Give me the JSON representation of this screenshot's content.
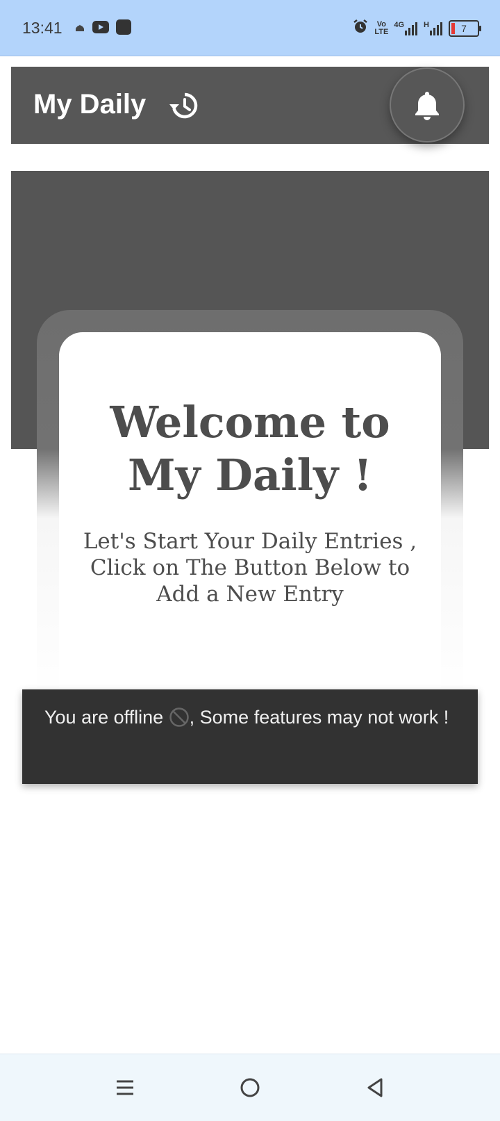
{
  "status_bar": {
    "time": "13:41",
    "left_icons": [
      "mosque-icon",
      "youtube-icon",
      "app-square-icon"
    ],
    "volte_top": "Vo",
    "volte_bottom": "LTE",
    "network_4g": "4G",
    "network_h": "H",
    "battery": "7"
  },
  "appbar": {
    "title": "My Daily",
    "history_icon": "history-icon",
    "bell_icon": "bell-icon"
  },
  "welcome_card": {
    "title": "Welcome to\nMy Daily !",
    "subtitle": "Let's Start Your Daily Entries , Click on The Button Below to Add a New Entry"
  },
  "snackbar": {
    "text_before": "You are offline ",
    "icon": "block-icon",
    "text_after": ", Some features may not work !"
  },
  "nav": {
    "icons": [
      "menu-icon",
      "home-icon",
      "back-icon"
    ]
  },
  "colors": {
    "status_bar": "#b3d4fb",
    "appbar": "#575757",
    "hero": "#555555",
    "snackbar": "#323232",
    "text_dark": "#4d4d4d"
  }
}
